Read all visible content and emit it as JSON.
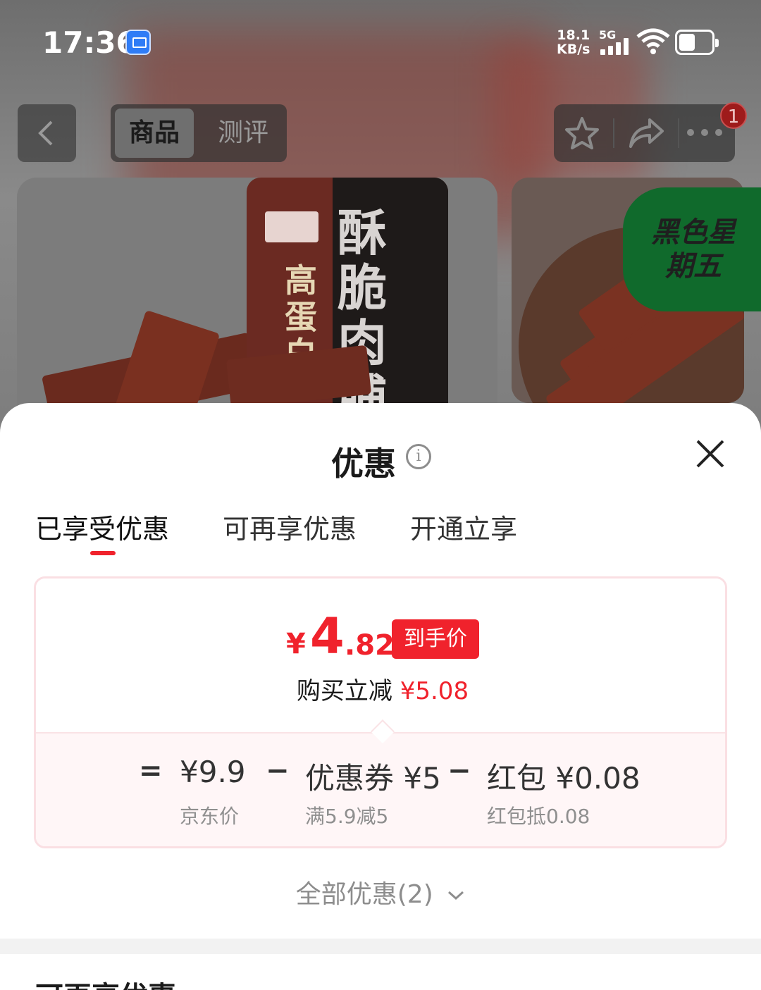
{
  "status_bar": {
    "time": "17:36",
    "net_speed_value": "18.1",
    "net_speed_unit": "KB/s",
    "net_type": "5G",
    "battery_level": 0.5
  },
  "nav": {
    "tab_product": "商品",
    "tab_review": "测评",
    "notification_count": "1"
  },
  "product": {
    "package_big_text": "酥脆肉脯",
    "package_side_text": "高蛋白",
    "promo_tag": "黑色星期五"
  },
  "sheet": {
    "title": "优惠",
    "info_icon": "i",
    "tabs": [
      {
        "label": "已享受优惠",
        "active": true
      },
      {
        "label": "可再享优惠",
        "active": false
      },
      {
        "label": "开通立享",
        "active": false
      }
    ],
    "price": {
      "currency": "¥",
      "integer": "4",
      "decimal": ".82",
      "tag": "到手价",
      "reduce_label": "购买立减",
      "reduce_value": "¥5.08"
    },
    "formula": {
      "equals": "=",
      "minus": "−",
      "items": [
        {
          "main": "¥9.9",
          "sub": "京东价"
        },
        {
          "main": "优惠券 ¥5",
          "sub": "满5.9减5"
        },
        {
          "main": "红包 ¥0.08",
          "sub": "红包抵0.08"
        }
      ]
    },
    "all_offers": "全部优惠(2)",
    "next_section_title": "可再享优惠"
  },
  "colors": {
    "accent_red": "#f0222c",
    "card_border": "#fadfe3",
    "card_bottom_bg": "#fff6f7",
    "promo_green": "#106a2c"
  }
}
